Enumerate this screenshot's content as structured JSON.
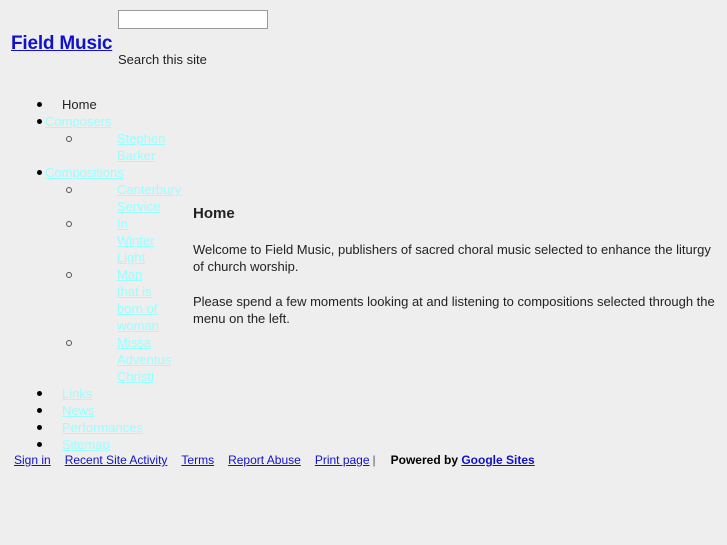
{
  "header": {
    "site_title": "Field Music",
    "search": {
      "value": "",
      "placeholder": "",
      "caption": "Search this site"
    }
  },
  "sidebar": {
    "items": [
      {
        "label": "Home",
        "type": "text",
        "marker": "disc",
        "children": []
      },
      {
        "label": "Composers",
        "type": "link",
        "marker": "disc",
        "children": [
          {
            "label": "Stephen Barker",
            "type": "link",
            "marker": "circle"
          }
        ]
      },
      {
        "label": "Compositions",
        "type": "link",
        "marker": "disc",
        "children": [
          {
            "label": "Canterbury Service",
            "type": "link",
            "marker": "circle"
          },
          {
            "label": "In Winter Light",
            "type": "link",
            "marker": "circle"
          },
          {
            "label": "Man that is born of woman",
            "type": "link",
            "marker": "circle"
          },
          {
            "label": "Missa Adventus Christi",
            "type": "link",
            "marker": "circle"
          }
        ]
      },
      {
        "label": "Links",
        "type": "link",
        "marker": "disc",
        "children": []
      },
      {
        "label": "News",
        "type": "link",
        "marker": "disc",
        "children": []
      },
      {
        "label": "Performances",
        "type": "link",
        "marker": "disc",
        "children": []
      },
      {
        "label": "Sitemap",
        "type": "link",
        "marker": "disc",
        "children": []
      }
    ]
  },
  "main": {
    "title": "Home",
    "paragraphs": [
      "Welcome to Field Music, publishers of sacred choral music selected to enhance the liturgy of church worship.",
      "Please spend a few moments looking at and listening to compositions selected through the menu on the left."
    ]
  },
  "footer": {
    "links": [
      "Sign in",
      "Recent Site Activity",
      "Terms",
      "Report Abuse",
      "Print page"
    ],
    "separator": "|",
    "powered_by_prefix": "Powered by",
    "powered_by_link": "Google Sites"
  },
  "colors": {
    "page_background": "#eeeeee",
    "nav_link": "#99ffff",
    "footer_link": "#1111cc",
    "title_link": "#1111cc",
    "body_text": "#222222"
  }
}
